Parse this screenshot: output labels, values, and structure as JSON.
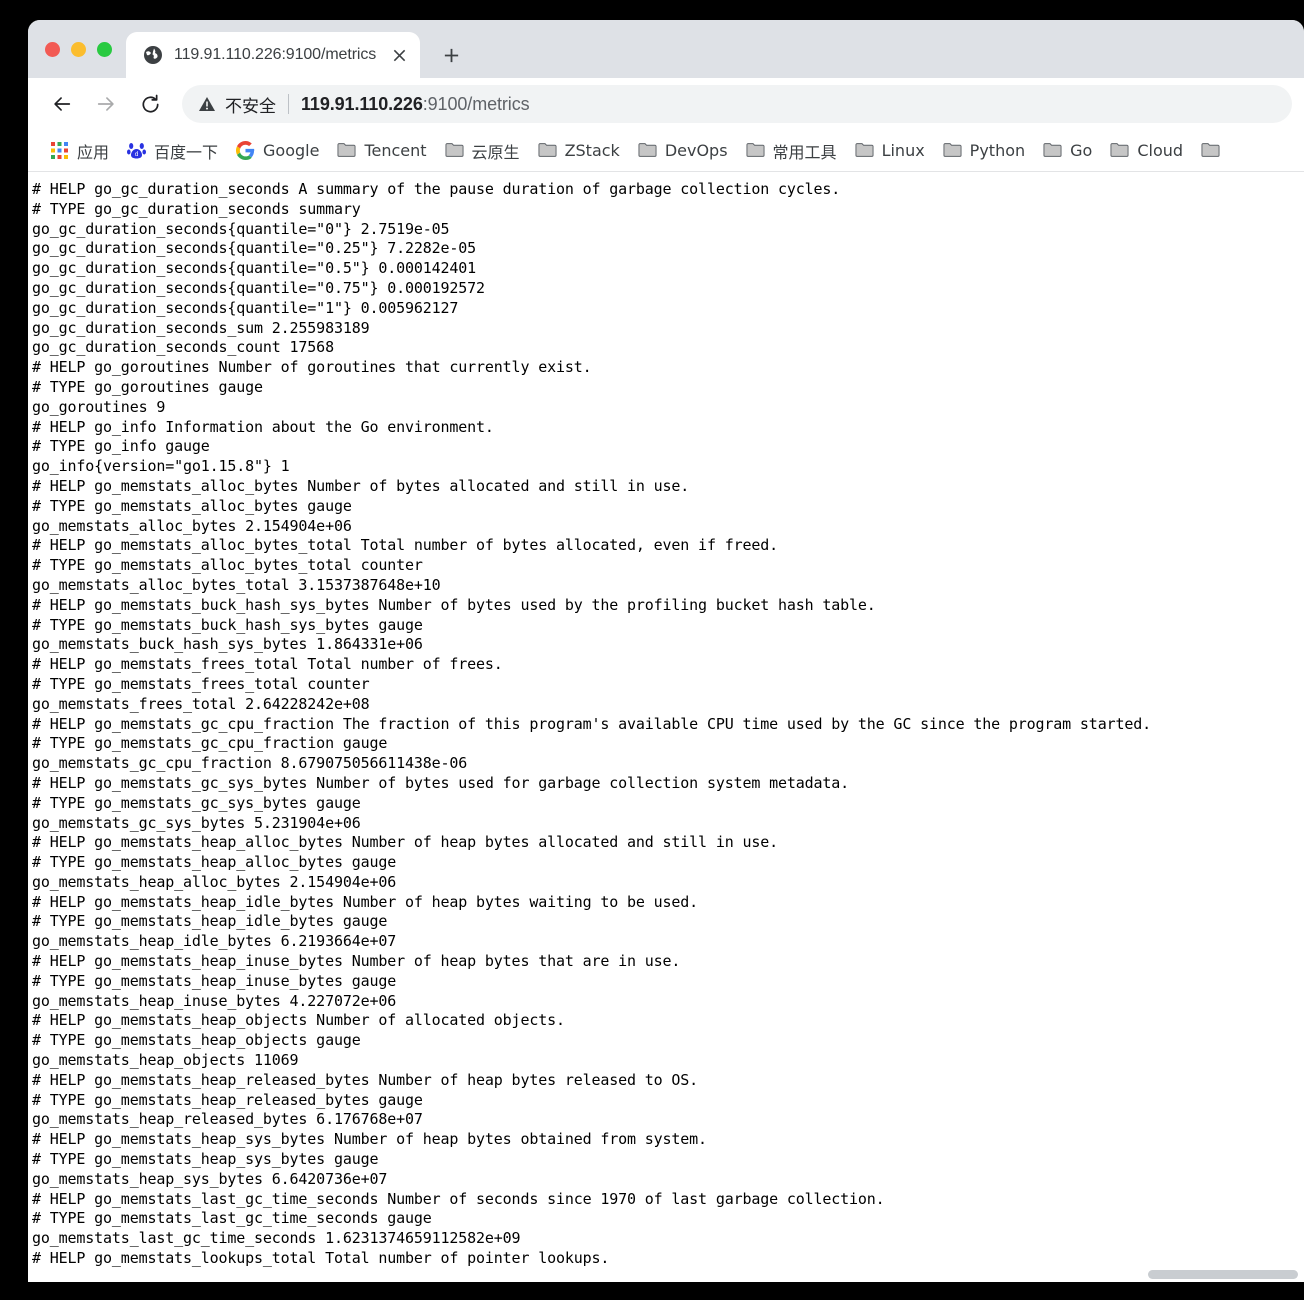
{
  "window": {
    "controls": [
      "close",
      "minimize",
      "maximize"
    ]
  },
  "tabstrip": {
    "tab_title": "119.91.110.226:9100/metrics",
    "close_label": "✕",
    "newtab_label": "+"
  },
  "toolbar": {
    "back_label": "←",
    "forward_label": "→",
    "reload_label": "⟳",
    "security_text": "不安全",
    "url_host": "119.91.110.226",
    "url_path": ":9100/metrics"
  },
  "bookmarks": {
    "items": [
      {
        "label": "应用",
        "icon": "apps-grid-icon"
      },
      {
        "label": "百度一下",
        "icon": "baidu-icon"
      },
      {
        "label": "Google",
        "icon": "google-icon"
      },
      {
        "label": "Tencent",
        "icon": "folder-icon"
      },
      {
        "label": "云原生",
        "icon": "folder-icon"
      },
      {
        "label": "ZStack",
        "icon": "folder-icon"
      },
      {
        "label": "DevOps",
        "icon": "folder-icon"
      },
      {
        "label": "常用工具",
        "icon": "folder-icon"
      },
      {
        "label": "Linux",
        "icon": "folder-icon"
      },
      {
        "label": "Python",
        "icon": "folder-icon"
      },
      {
        "label": "Go",
        "icon": "folder-icon"
      },
      {
        "label": "Cloud",
        "icon": "folder-icon"
      },
      {
        "label": "",
        "icon": "folder-icon"
      }
    ]
  },
  "page": {
    "metrics_text": "# HELP go_gc_duration_seconds A summary of the pause duration of garbage collection cycles.\n# TYPE go_gc_duration_seconds summary\ngo_gc_duration_seconds{quantile=\"0\"} 2.7519e-05\ngo_gc_duration_seconds{quantile=\"0.25\"} 7.2282e-05\ngo_gc_duration_seconds{quantile=\"0.5\"} 0.000142401\ngo_gc_duration_seconds{quantile=\"0.75\"} 0.000192572\ngo_gc_duration_seconds{quantile=\"1\"} 0.005962127\ngo_gc_duration_seconds_sum 2.255983189\ngo_gc_duration_seconds_count 17568\n# HELP go_goroutines Number of goroutines that currently exist.\n# TYPE go_goroutines gauge\ngo_goroutines 9\n# HELP go_info Information about the Go environment.\n# TYPE go_info gauge\ngo_info{version=\"go1.15.8\"} 1\n# HELP go_memstats_alloc_bytes Number of bytes allocated and still in use.\n# TYPE go_memstats_alloc_bytes gauge\ngo_memstats_alloc_bytes 2.154904e+06\n# HELP go_memstats_alloc_bytes_total Total number of bytes allocated, even if freed.\n# TYPE go_memstats_alloc_bytes_total counter\ngo_memstats_alloc_bytes_total 3.1537387648e+10\n# HELP go_memstats_buck_hash_sys_bytes Number of bytes used by the profiling bucket hash table.\n# TYPE go_memstats_buck_hash_sys_bytes gauge\ngo_memstats_buck_hash_sys_bytes 1.864331e+06\n# HELP go_memstats_frees_total Total number of frees.\n# TYPE go_memstats_frees_total counter\ngo_memstats_frees_total 2.64228242e+08\n# HELP go_memstats_gc_cpu_fraction The fraction of this program's available CPU time used by the GC since the program started.\n# TYPE go_memstats_gc_cpu_fraction gauge\ngo_memstats_gc_cpu_fraction 8.679075056611438e-06\n# HELP go_memstats_gc_sys_bytes Number of bytes used for garbage collection system metadata.\n# TYPE go_memstats_gc_sys_bytes gauge\ngo_memstats_gc_sys_bytes 5.231904e+06\n# HELP go_memstats_heap_alloc_bytes Number of heap bytes allocated and still in use.\n# TYPE go_memstats_heap_alloc_bytes gauge\ngo_memstats_heap_alloc_bytes 2.154904e+06\n# HELP go_memstats_heap_idle_bytes Number of heap bytes waiting to be used.\n# TYPE go_memstats_heap_idle_bytes gauge\ngo_memstats_heap_idle_bytes 6.2193664e+07\n# HELP go_memstats_heap_inuse_bytes Number of heap bytes that are in use.\n# TYPE go_memstats_heap_inuse_bytes gauge\ngo_memstats_heap_inuse_bytes 4.227072e+06\n# HELP go_memstats_heap_objects Number of allocated objects.\n# TYPE go_memstats_heap_objects gauge\ngo_memstats_heap_objects 11069\n# HELP go_memstats_heap_released_bytes Number of heap bytes released to OS.\n# TYPE go_memstats_heap_released_bytes gauge\ngo_memstats_heap_released_bytes 6.176768e+07\n# HELP go_memstats_heap_sys_bytes Number of heap bytes obtained from system.\n# TYPE go_memstats_heap_sys_bytes gauge\ngo_memstats_heap_sys_bytes 6.6420736e+07\n# HELP go_memstats_last_gc_time_seconds Number of seconds since 1970 of last garbage collection.\n# TYPE go_memstats_last_gc_time_seconds gauge\ngo_memstats_last_gc_time_seconds 1.6231374659112582e+09\n# HELP go_memstats_lookups_total Total number of pointer lookups."
  },
  "colors": {
    "tabstrip_bg": "#dee1e6",
    "toolbar_bg": "#ffffff",
    "omnibox_bg": "#f1f3f4",
    "text": "#202124",
    "close_dot": "#f25a54",
    "min_dot": "#fbbd2e",
    "max_dot": "#29ca41"
  }
}
